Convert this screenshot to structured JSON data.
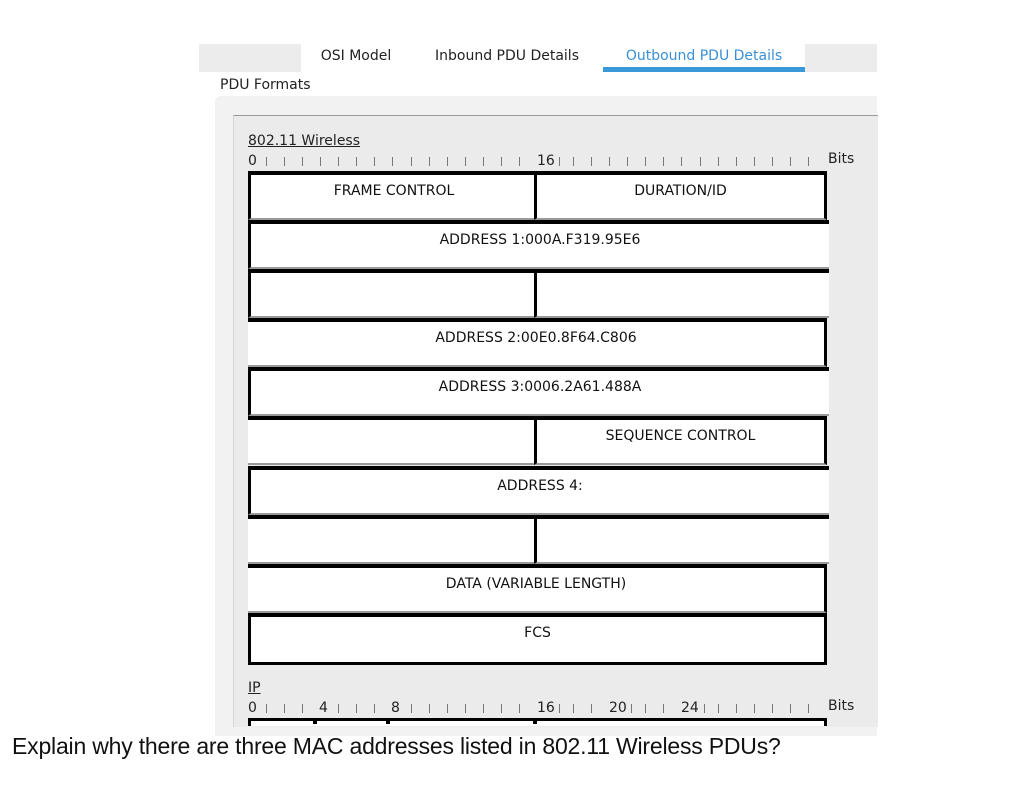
{
  "tabs": [
    {
      "label": "OSI Model",
      "active": false
    },
    {
      "label": "Inbound PDU Details",
      "active": false
    },
    {
      "label": "Outbound PDU Details",
      "active": true
    }
  ],
  "accent_color": "#3a9ad9",
  "pdu_formats_label": "PDU Formats",
  "wireless": {
    "title": "802.11 Wireless",
    "ruler": {
      "start": "0",
      "mid": "16",
      "unit": "Bits"
    },
    "fields": {
      "frame_control": "FRAME CONTROL",
      "duration_id": "DURATION/ID",
      "address1": "ADDRESS 1:000A.F319.95E6",
      "address2": "ADDRESS 2:00E0.8F64.C806",
      "address3": "ADDRESS 3:0006.2A61.488A",
      "sequence_control": "SEQUENCE CONTROL",
      "address4": "ADDRESS 4:",
      "data": "DATA (VARIABLE LENGTH)",
      "fcs": "FCS"
    }
  },
  "ip": {
    "title": "IP",
    "ruler": {
      "n0": "0",
      "n4": "4",
      "n8": "8",
      "n16": "16",
      "n20": "20",
      "n24": "24",
      "unit": "Bits"
    }
  },
  "question": "Explain why there are three MAC addresses listed in 802.11 Wireless PDUs?"
}
